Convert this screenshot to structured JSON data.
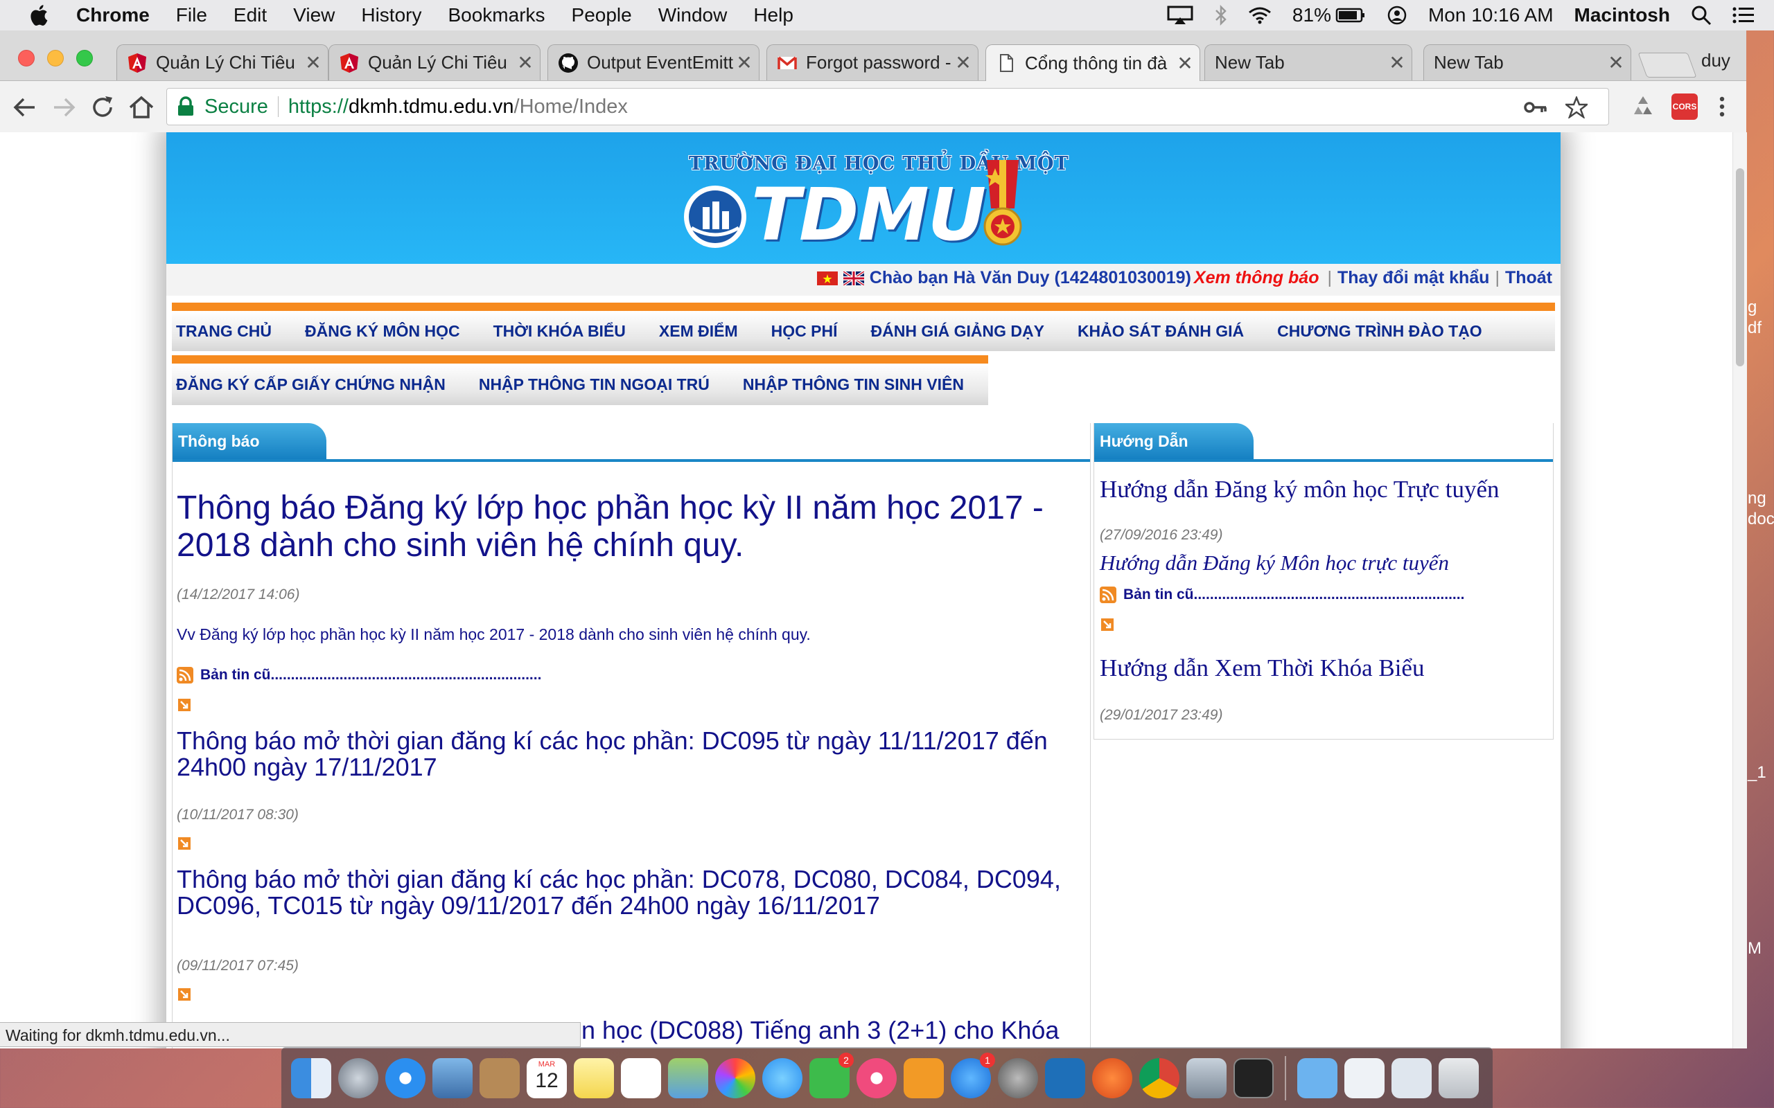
{
  "menubar": {
    "app": "Chrome",
    "items": [
      "File",
      "Edit",
      "View",
      "History",
      "Bookmarks",
      "People",
      "Window",
      "Help"
    ],
    "battery": "81%",
    "clock": "Mon 10:16 AM",
    "computer": "Macintosh"
  },
  "tabs": [
    {
      "title": "Quản Lý Chi Tiêu",
      "icon": "angular-icon"
    },
    {
      "title": "Quản Lý Chi Tiêu",
      "icon": "angular-icon"
    },
    {
      "title": "Output EventEmitt",
      "icon": "github-icon"
    },
    {
      "title": "Forgot password -",
      "icon": "gmail-icon"
    },
    {
      "title": "Cổng thông tin đà",
      "icon": "page-icon",
      "active": true
    },
    {
      "title": "New Tab",
      "icon": ""
    },
    {
      "title": "New Tab",
      "icon": ""
    }
  ],
  "profile": "duy",
  "omnibox": {
    "secure": "Secure",
    "scheme": "https://",
    "host": "dkmh.tdmu.edu.vn",
    "path": "/Home/Index"
  },
  "extensions": {
    "cors": "CORS"
  },
  "site": {
    "logo_top": "TRƯỜNG ĐẠI HỌC THỦ DẦU MỘT",
    "logo_main": "TDMU",
    "greeting": "Chào bạn Hà Văn Duy (1424801030019)",
    "notice_link": "Xem thông báo",
    "change_password": "Thay đổi mật khẩu",
    "logout": "Thoát",
    "nav_row1": [
      "TRANG CHỦ",
      "ĐĂNG KÝ MÔN HỌC",
      "THỜI KHÓA BIỂU",
      "XEM ĐIỂM",
      "HỌC PHÍ",
      "ĐÁNH GIÁ GIẢNG DẠY",
      "KHẢO SÁT ĐÁNH GIÁ",
      "CHƯƠNG TRÌNH ĐÀO TẠO"
    ],
    "nav_row2": [
      "ĐĂNG KÝ CẤP GIẤY CHỨNG NHẬN",
      "NHẬP THÔNG TIN NGOẠI TRÚ",
      "NHẬP THÔNG TIN SINH VIÊN"
    ],
    "left_panel_title": "Thông báo",
    "right_panel_title": "Hướng Dẫn",
    "news": [
      {
        "title": "Thông báo Đăng ký lớp học phần học kỳ II năm học 2017 - 2018 dành cho sinh viên hệ chính quy.",
        "date": "(14/12/2017 14:06)",
        "summary": "Vv Đăng ký lớp học phần học kỳ II năm học 2017 - 2018 dành cho sinh viên hệ chính quy."
      },
      {
        "title": "Thông báo mở thời gian đăng kí các học phần: DC095 từ ngày 11/11/2017 đến 24h00 ngày 17/11/2017",
        "date": "(10/11/2017 08:30)"
      },
      {
        "title": "Thông báo mở thời gian đăng kí các học phần: DC078, DC080, DC084, DC094, DC096, TC015 từ ngày 09/11/2017 đến 24h00 ngày 16/11/2017",
        "date": "(09/11/2017 07:45)"
      },
      {
        "title_partial": "n học (DC088) Tiếng anh 3 (2+1) cho Khóa"
      }
    ],
    "old_news_label": "Bản tin cũ...................................................................",
    "old_news_label_right": "Bản tin cũ...................................................................",
    "guides": [
      {
        "title": "Hướng dẫn Đăng ký môn học Trực tuyến",
        "date": "(27/09/2016 23:49)",
        "subtitle": "Hướng dẫn Đăng ký Môn học trực tuyến"
      },
      {
        "title": "Hướng dẫn Xem Thời Khóa Biểu",
        "date": "(29/01/2017 23:49)"
      }
    ]
  },
  "status": "Waiting for dkmh.tdmu.edu.vn...",
  "desktop_fragments": [
    "g",
    "df",
    "ng",
    "doc",
    "_1",
    "M"
  ],
  "dock": {
    "calendar_month": "MAR",
    "calendar_day": "12",
    "facetime_badge": "2",
    "appstore_badge": "1"
  }
}
